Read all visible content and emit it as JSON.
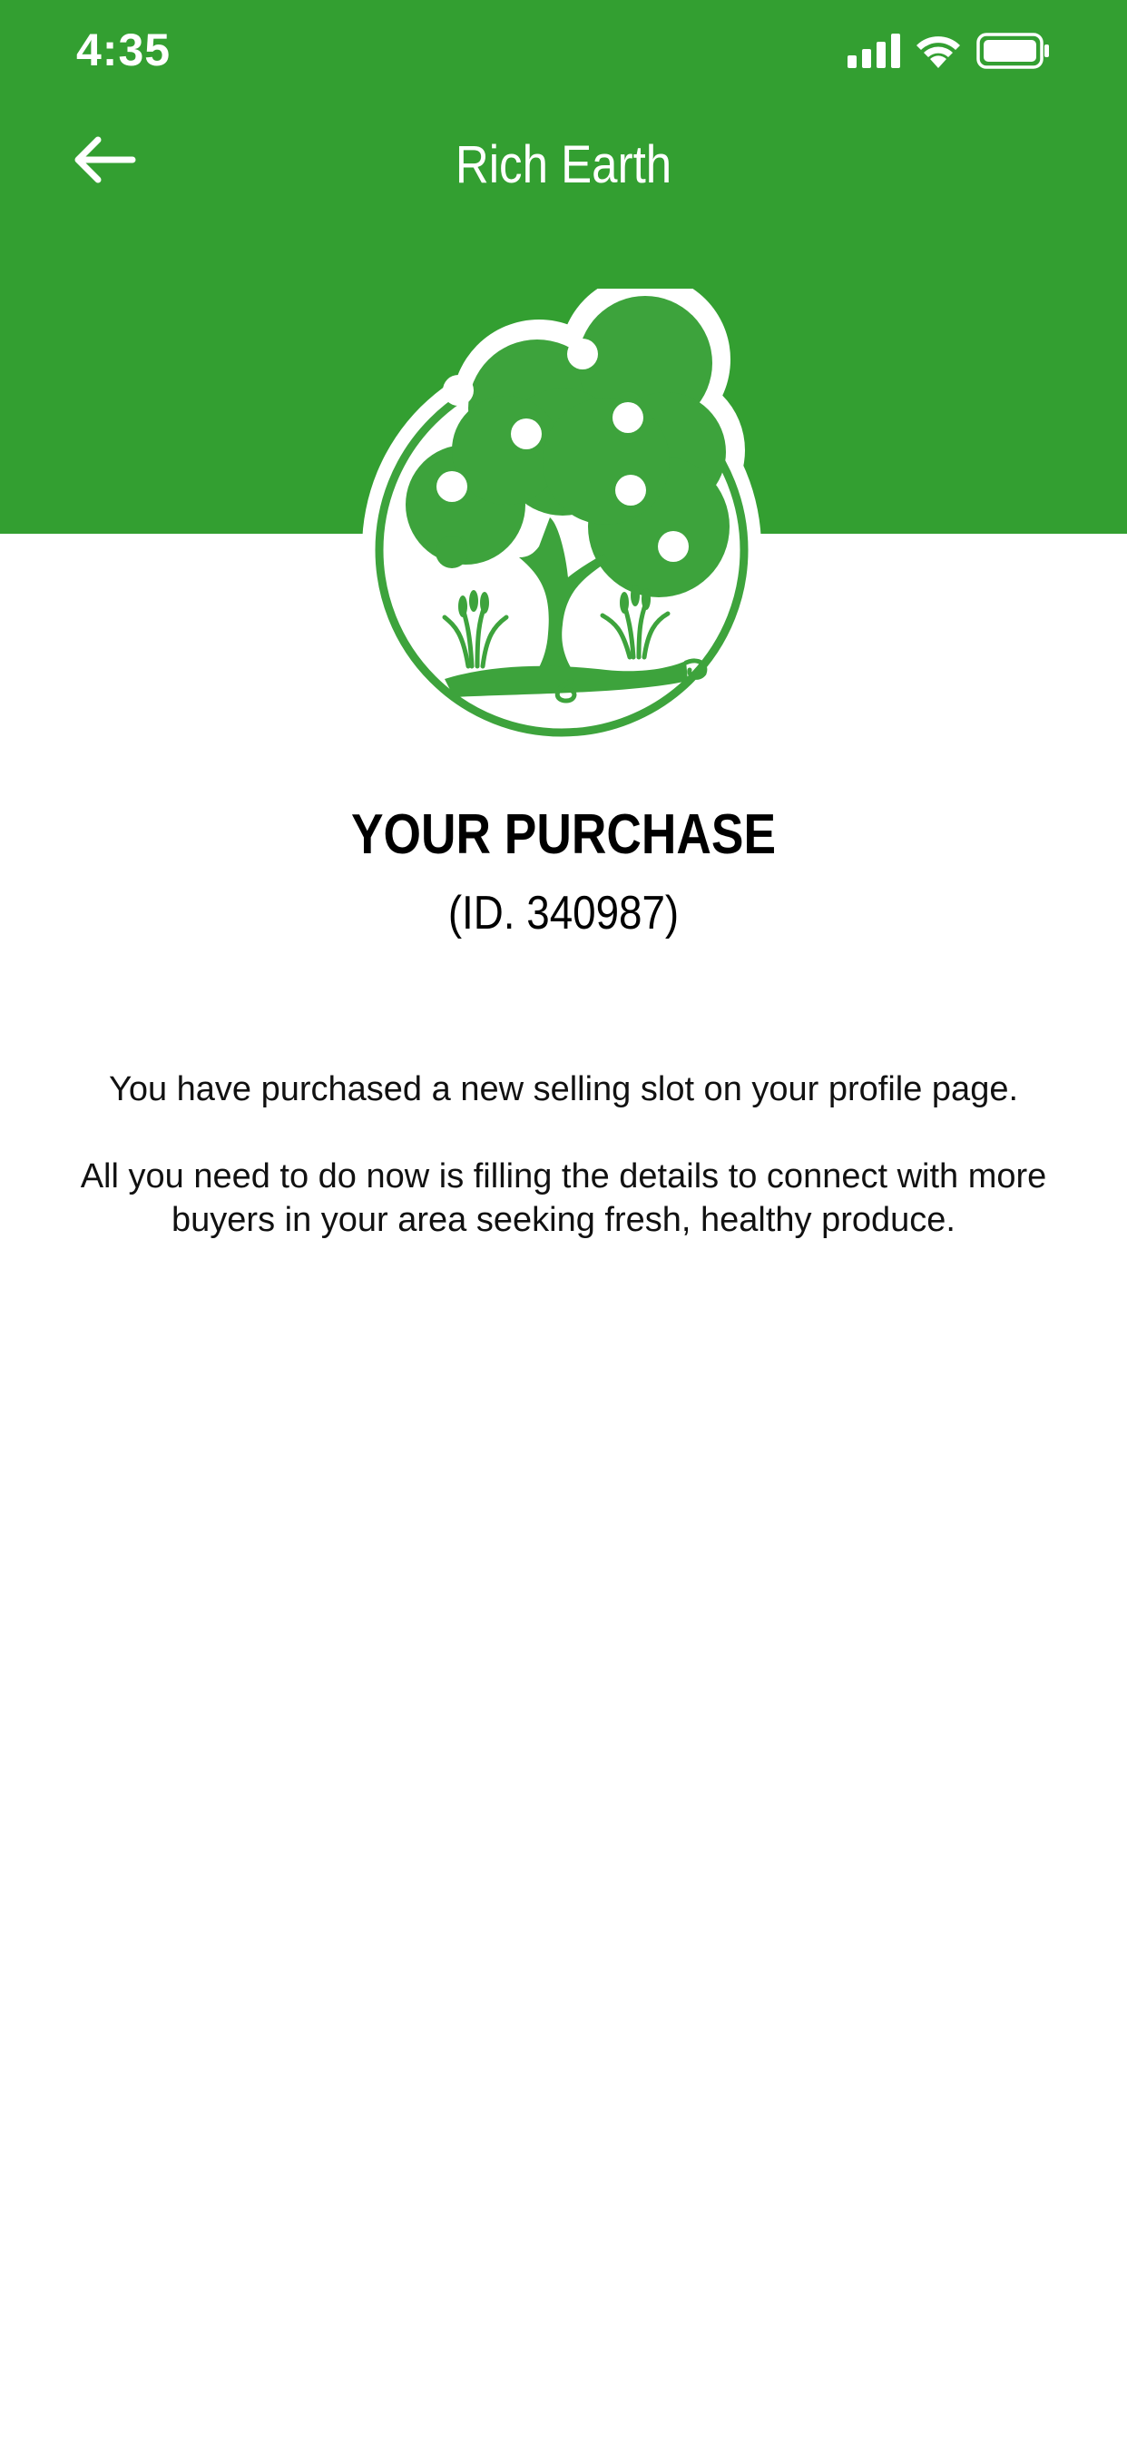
{
  "status_bar": {
    "time": "4:35",
    "icons": [
      "signal-icon",
      "wifi-icon",
      "battery-icon"
    ]
  },
  "header": {
    "title": "Rich Earth",
    "back_icon": "arrow-left-icon",
    "background_color": "#339f31"
  },
  "logo": {
    "icon": "tree-logo-icon",
    "color": "#3da33c"
  },
  "purchase": {
    "title": "YOUR PURCHASE",
    "id_text": "(ID. 340987)"
  },
  "message": {
    "line1": "You have purchased a new selling slot on your profile page.",
    "line2": "All you need to do now is filling the details to connect with more buyers in your area seeking fresh, healthy produce."
  }
}
